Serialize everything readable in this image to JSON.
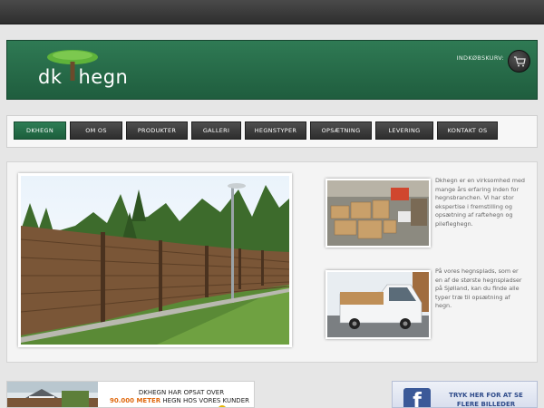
{
  "header": {
    "logo_text_left": "dk",
    "logo_text_right": "hegn",
    "cart_label": "INDKØBSKURV:"
  },
  "nav": {
    "items": [
      {
        "label": "DKHEGN",
        "active": true
      },
      {
        "label": "OM OS"
      },
      {
        "label": "PRODUKTER"
      },
      {
        "label": "GALLERI"
      },
      {
        "label": "HEGNSTYPER"
      },
      {
        "label": "OPSÆTNING"
      },
      {
        "label": "LEVERING"
      },
      {
        "label": "KONTAKT OS"
      }
    ]
  },
  "content": {
    "para1": "Dkhegn er en virksomhed med mange års erfaring inden for hegnsbranchen. Vi har stor ekspertise i fremstilling og opsætning af raftehegn og pilefleghegn.",
    "para2": "På vores hegnsplads, som er en af de største hegnspladser på Sjølland, kan du finde alle typer træ til opsætning af hegn."
  },
  "banner": {
    "line1": "DKHEGN HAR OPSAT OVER",
    "highlight": "90.000 METER",
    "line2_rest": " HEGN HOS VORES KUNDER"
  },
  "facebook": {
    "icon_letter": "f",
    "text": "TRYK HER FOR AT SE FLERE BILLEDER"
  },
  "colors": {
    "brand_green": "#1f5d3e",
    "nav_dark": "#2d2d2d",
    "highlight_orange": "#e06a10",
    "facebook_blue": "#3b5998"
  }
}
